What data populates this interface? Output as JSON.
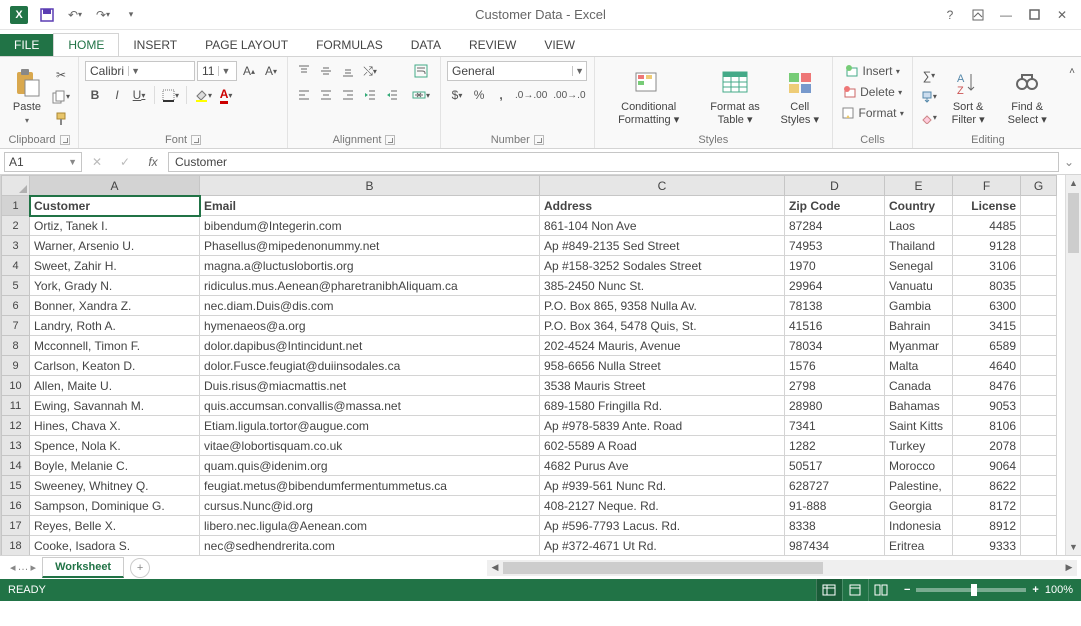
{
  "title": "Customer Data - Excel",
  "qat": {
    "save": "💾",
    "undo": "↶",
    "redo": "↷"
  },
  "tabs": [
    "FILE",
    "HOME",
    "INSERT",
    "PAGE LAYOUT",
    "FORMULAS",
    "DATA",
    "REVIEW",
    "VIEW"
  ],
  "activeTab": "HOME",
  "ribbon": {
    "clipboard": {
      "label": "Clipboard",
      "paste": "Paste"
    },
    "font": {
      "label": "Font",
      "name": "Calibri",
      "size": "11",
      "bold": "B",
      "italic": "I",
      "underline": "U"
    },
    "alignment": {
      "label": "Alignment",
      "wrap": "Wrap Text",
      "merge": "Merge & Center"
    },
    "number": {
      "label": "Number",
      "format": "General"
    },
    "styles": {
      "label": "Styles",
      "cond": "Conditional Formatting",
      "table": "Format as Table",
      "cell": "Cell Styles"
    },
    "cells": {
      "label": "Cells",
      "insert": "Insert",
      "delete": "Delete",
      "format": "Format"
    },
    "editing": {
      "label": "Editing",
      "sort": "Sort & Filter",
      "find": "Find & Select"
    }
  },
  "namebox": "A1",
  "formula": "Customer",
  "columns": [
    "A",
    "B",
    "C",
    "D",
    "E",
    "F",
    "G"
  ],
  "headers": {
    "A": "Customer",
    "B": "Email",
    "C": "Address",
    "D": "Zip Code",
    "E": "Country",
    "F": "License",
    "G": ""
  },
  "rows": [
    {
      "n": 2,
      "A": "Ortiz, Tanek I.",
      "B": "bibendum@Integerin.com",
      "C": "861-104 Non Ave",
      "D": "87284",
      "E": "Laos",
      "F": "4485"
    },
    {
      "n": 3,
      "A": "Warner, Arsenio U.",
      "B": "Phasellus@mipedenonummy.net",
      "C": "Ap #849-2135 Sed Street",
      "D": "74953",
      "E": "Thailand",
      "F": "9128"
    },
    {
      "n": 4,
      "A": "Sweet, Zahir H.",
      "B": "magna.a@luctuslobortis.org",
      "C": "Ap #158-3252 Sodales Street",
      "D": "1970",
      "E": "Senegal",
      "F": "3106"
    },
    {
      "n": 5,
      "A": "York, Grady N.",
      "B": "ridiculus.mus.Aenean@pharetranibhAliquam.ca",
      "C": "385-2450 Nunc St.",
      "D": "29964",
      "E": "Vanuatu",
      "F": "8035"
    },
    {
      "n": 6,
      "A": "Bonner, Xandra Z.",
      "B": "nec.diam.Duis@dis.com",
      "C": "P.O. Box 865, 9358 Nulla Av.",
      "D": "78138",
      "E": "Gambia",
      "F": "6300"
    },
    {
      "n": 7,
      "A": "Landry, Roth A.",
      "B": "hymenaeos@a.org",
      "C": "P.O. Box 364, 5478 Quis, St.",
      "D": "41516",
      "E": "Bahrain",
      "F": "3415"
    },
    {
      "n": 8,
      "A": "Mcconnell, Timon F.",
      "B": "dolor.dapibus@Intincidunt.net",
      "C": "202-4524 Mauris, Avenue",
      "D": "78034",
      "E": "Myanmar",
      "F": "6589"
    },
    {
      "n": 9,
      "A": "Carlson, Keaton D.",
      "B": "dolor.Fusce.feugiat@duiinsodales.ca",
      "C": "958-6656 Nulla Street",
      "D": "1576",
      "E": "Malta",
      "F": "4640"
    },
    {
      "n": 10,
      "A": "Allen, Maite U.",
      "B": "Duis.risus@miacmattis.net",
      "C": "3538 Mauris Street",
      "D": "2798",
      "E": "Canada",
      "F": "8476"
    },
    {
      "n": 11,
      "A": "Ewing, Savannah M.",
      "B": "quis.accumsan.convallis@massa.net",
      "C": "689-1580 Fringilla Rd.",
      "D": "28980",
      "E": "Bahamas",
      "F": "9053"
    },
    {
      "n": 12,
      "A": "Hines, Chava X.",
      "B": "Etiam.ligula.tortor@augue.com",
      "C": "Ap #978-5839 Ante. Road",
      "D": "7341",
      "E": "Saint Kitts",
      "F": "8106"
    },
    {
      "n": 13,
      "A": "Spence, Nola K.",
      "B": "vitae@lobortisquam.co.uk",
      "C": "602-5589 A Road",
      "D": "1282",
      "E": "Turkey",
      "F": "2078"
    },
    {
      "n": 14,
      "A": "Boyle, Melanie C.",
      "B": "quam.quis@idenim.org",
      "C": "4682 Purus Ave",
      "D": "50517",
      "E": "Morocco",
      "F": "9064"
    },
    {
      "n": 15,
      "A": "Sweeney, Whitney Q.",
      "B": "feugiat.metus@bibendumfermentummetus.ca",
      "C": "Ap #939-561 Nunc Rd.",
      "D": "628727",
      "E": "Palestine,",
      "F": "8622"
    },
    {
      "n": 16,
      "A": "Sampson, Dominique G.",
      "B": "cursus.Nunc@id.org",
      "C": "408-2127 Neque. Rd.",
      "D": "91-888",
      "E": "Georgia",
      "F": "8172"
    },
    {
      "n": 17,
      "A": "Reyes, Belle X.",
      "B": "libero.nec.ligula@Aenean.com",
      "C": "Ap #596-7793 Lacus. Rd.",
      "D": "8338",
      "E": "Indonesia",
      "F": "8912"
    },
    {
      "n": 18,
      "A": "Cooke, Isadora S.",
      "B": "nec@sedhendrerita.com",
      "C": "Ap #372-4671 Ut Rd.",
      "D": "987434",
      "E": "Eritrea",
      "F": "9333"
    }
  ],
  "sheet": "Worksheet",
  "status": "READY",
  "zoom": "100%"
}
